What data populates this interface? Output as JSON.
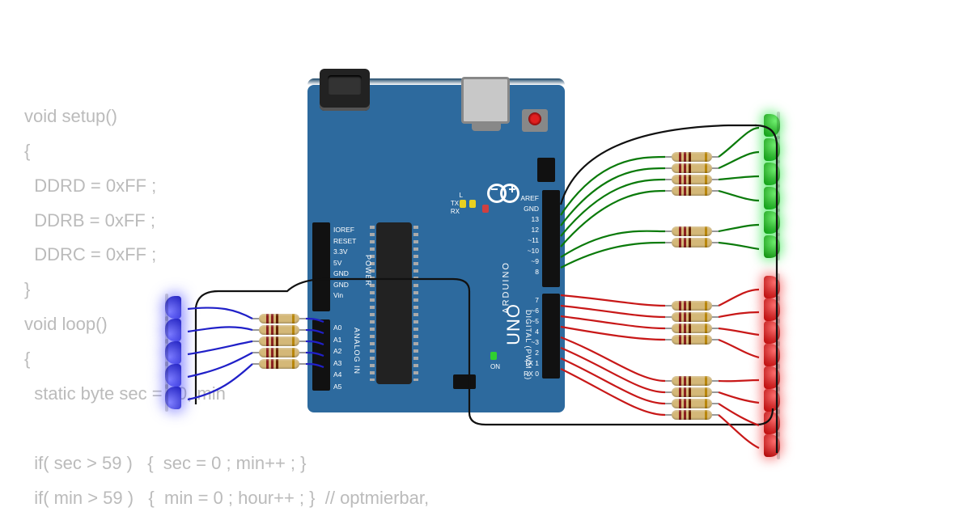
{
  "code": {
    "l1": "void setup()",
    "l2": "{",
    "l3": "  DDRD = 0xFF ;",
    "l4": "  DDRB = 0xFF ;",
    "l5": "  DDRC = 0xFF ;",
    "l6": "}",
    "l7": "void loop()",
    "l8": "{",
    "l9": "  static byte sec = 40, min",
    "l10": "",
    "l11": "  if( sec > 59 )   {  sec = 0 ; min++ ; }",
    "l12": "  if( min > 59 )   {  min = 0 ; hour++ ; }  // optmierbar,"
  },
  "board": {
    "model_prefix": "ARDUINO",
    "model": "UNO",
    "labels_right_top": [
      "AREF",
      "GND",
      "13",
      "12",
      "~11",
      "~10",
      "~9",
      "8"
    ],
    "labels_right_bot": [
      "7",
      "~6",
      "~5",
      "4",
      "~3",
      "2",
      "TX 1",
      "RX 0"
    ],
    "labels_left_power": [
      "IOREF",
      "RESET",
      "3.3V",
      "5V",
      "GND",
      "GND",
      "Vin"
    ],
    "labels_left_analog": [
      "A0",
      "A1",
      "A2",
      "A3",
      "A4",
      "A5"
    ],
    "section_power": "POWER",
    "section_analog": "ANALOG IN",
    "section_digital": "DIGITAL (PWM ~)",
    "tx_label": "TX",
    "rx_label": "RX",
    "l_label": "L",
    "on_label": "ON"
  },
  "components": {
    "greenLeds": 6,
    "redLeds": 8,
    "blueLeds": 5,
    "resistorGroups": 5,
    "colors": {
      "green": "#0a8a0a",
      "red": "#c81818",
      "blue": "#2020c8",
      "wire_black": "#111111"
    }
  }
}
